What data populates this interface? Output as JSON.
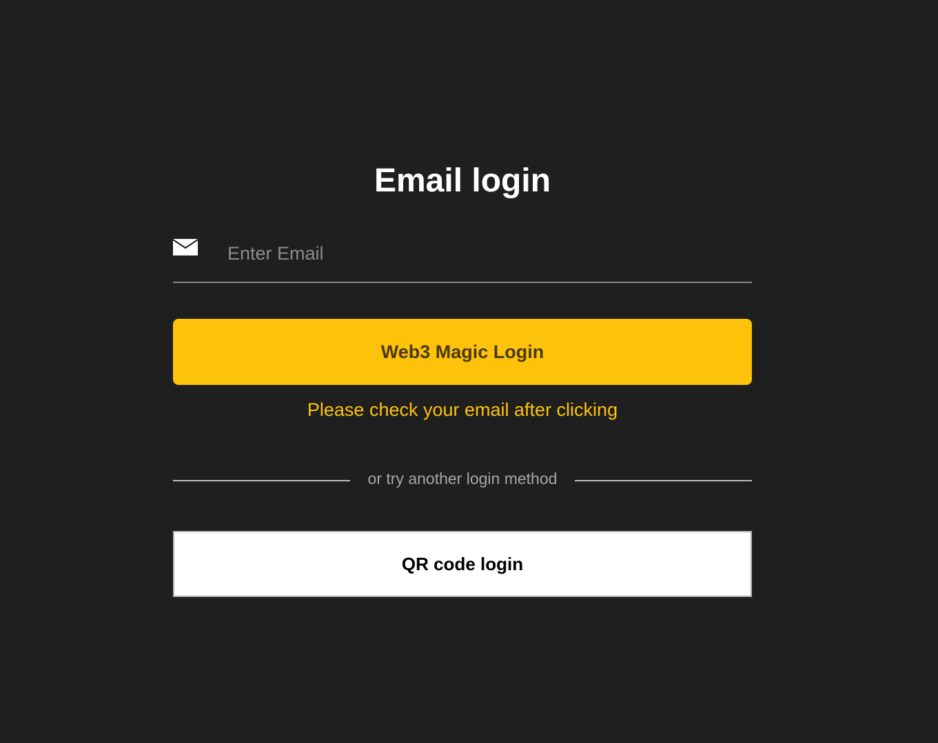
{
  "login": {
    "title": "Email login",
    "email": {
      "icon": "mail-icon",
      "placeholder": "Enter Email",
      "value": ""
    },
    "magic_button_label": "Web3 Magic Login",
    "hint": "Please check your email after clicking",
    "divider_text": "or try another login method",
    "qr_button_label": "QR code login"
  },
  "colors": {
    "background": "#1f1f1f",
    "accent": "#fdc20a",
    "accent_text": "#4a3a10",
    "title": "#ffffff",
    "placeholder": "#8c8c8c",
    "divider": "#bdbdbd"
  }
}
